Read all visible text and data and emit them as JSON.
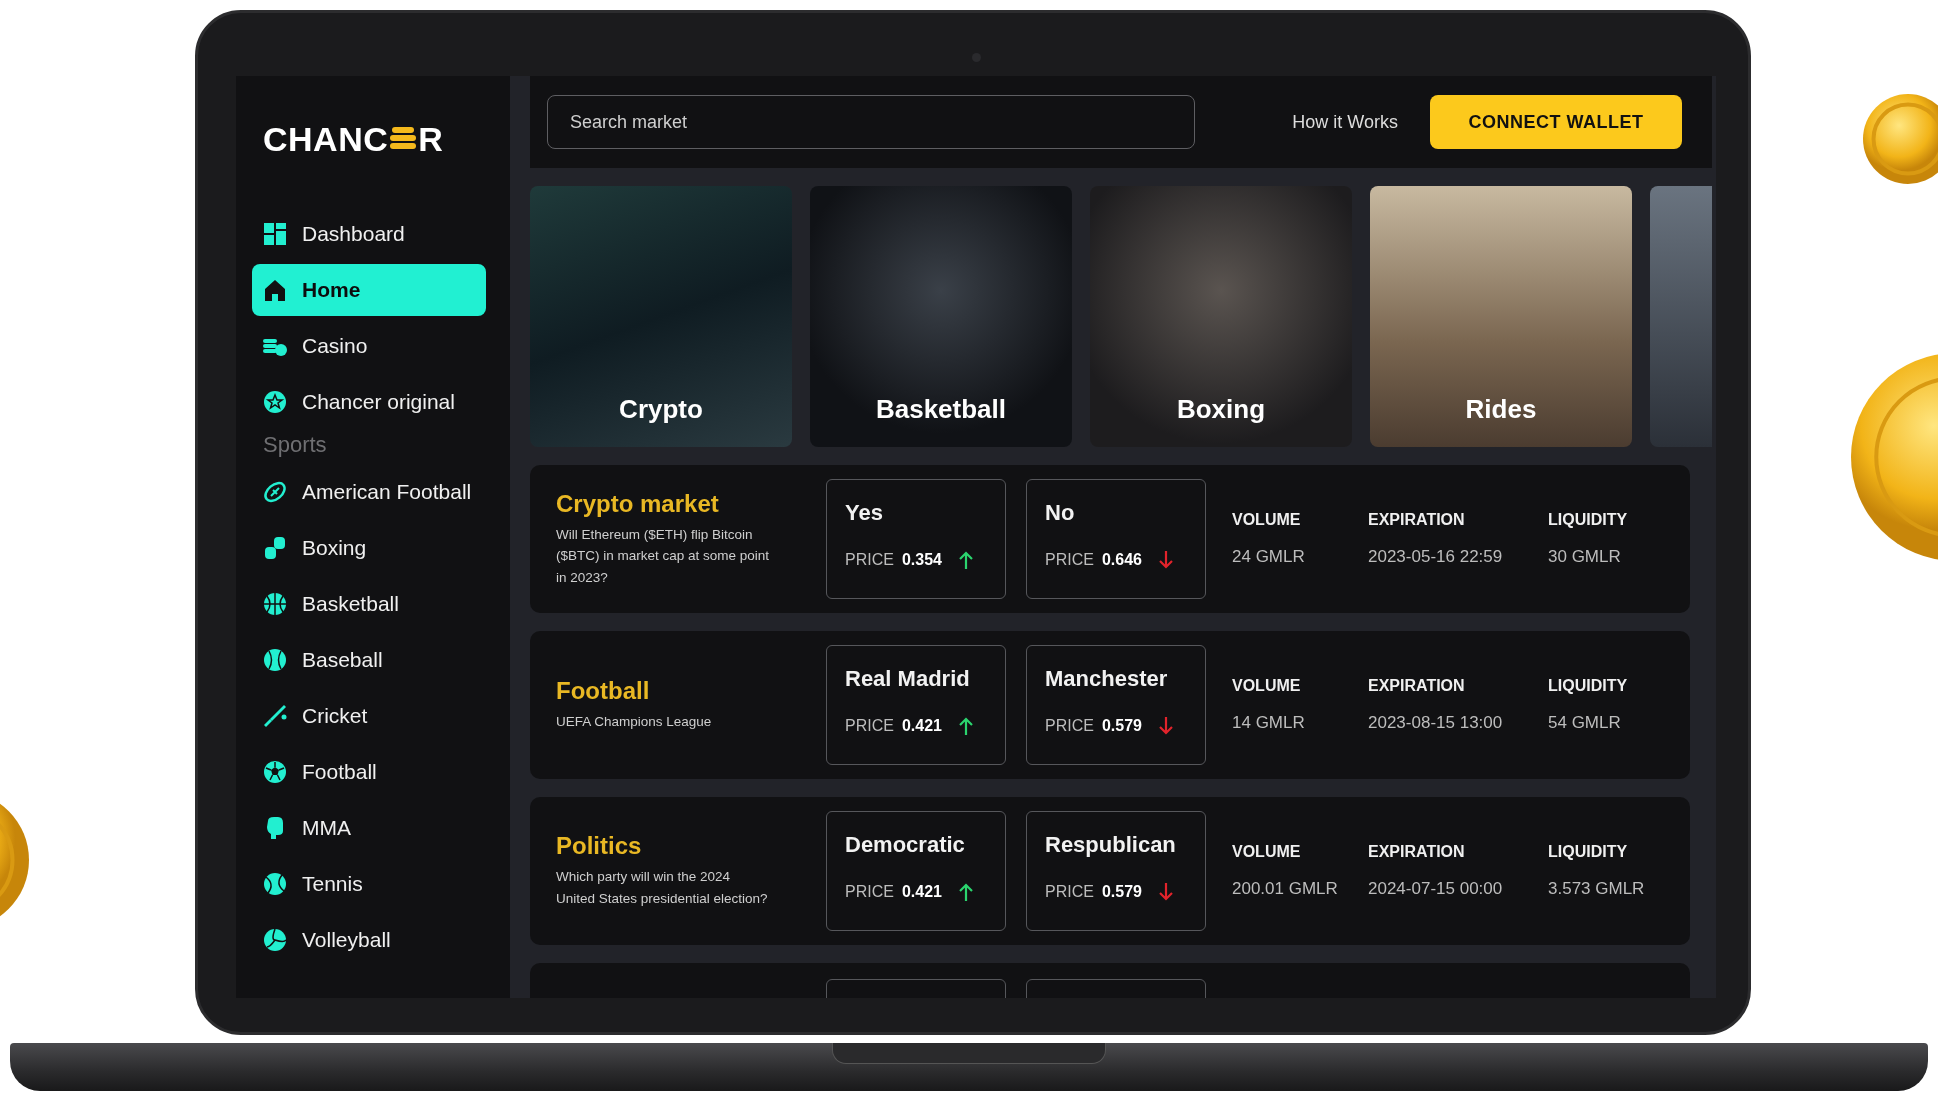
{
  "sidebar": {
    "logo": [
      "CHANC",
      "R"
    ],
    "menu": [
      {
        "label": "Dashboard",
        "selected": false
      },
      {
        "label": "Home",
        "selected": true
      },
      {
        "label": "Casino",
        "selected": false
      },
      {
        "label": "Chancer original",
        "selected": false
      }
    ],
    "sports_heading": "Sports",
    "sports": [
      {
        "label": "American Football",
        "selected": false
      },
      {
        "label": "Boxing",
        "selected": false
      },
      {
        "label": "Basketball",
        "selected": false
      },
      {
        "label": "Baseball",
        "selected": false
      },
      {
        "label": "Cricket",
        "selected": false
      },
      {
        "label": "Football",
        "selected": false
      },
      {
        "label": "MMA",
        "selected": false
      },
      {
        "label": "Tennis",
        "selected": false
      },
      {
        "label": "Volleyball",
        "selected": false
      }
    ]
  },
  "header": {
    "search": {
      "placeholder": "Search market"
    },
    "link": "How it Works",
    "button": "CONNECT WALLET"
  },
  "categories": [
    {
      "label": "Crypto"
    },
    {
      "label": "Basketball"
    },
    {
      "label": "Boxing"
    },
    {
      "label": "Rides"
    }
  ],
  "markets": [
    {
      "title": "Crypto market",
      "description": "Will Ethereum ($ETH) flip Bitcoin ($BTC) in market cap at some point in 2023?",
      "options": [
        {
          "name": "Yes",
          "price_label": "PRICE",
          "price": "0.354",
          "kind": "up"
        },
        {
          "name": "No",
          "price_label": "PRICE",
          "price": "0.646",
          "kind": "down"
        }
      ],
      "stats": [
        {
          "label": "VOLUME",
          "value": "24 GMLR"
        },
        {
          "label": "EXPIRATION",
          "value": "2023-05-16 22:59"
        },
        {
          "label": "LIQUIDITY",
          "value": "30 GMLR"
        }
      ]
    },
    {
      "title": "Football",
      "description": "UEFA Champions League",
      "options": [
        {
          "name": "Real Madrid",
          "price_label": "PRICE",
          "price": "0.421",
          "kind": "up"
        },
        {
          "name": "Manchester",
          "price_label": "PRICE",
          "price": "0.579",
          "kind": "down"
        }
      ],
      "stats": [
        {
          "label": "VOLUME",
          "value": "14 GMLR"
        },
        {
          "label": "EXPIRATION",
          "value": "2023-08-15 13:00"
        },
        {
          "label": "LIQUIDITY",
          "value": "54 GMLR"
        }
      ]
    },
    {
      "title": "Politics",
      "description": "Which party will win the 2024 United States presidential election?",
      "options": [
        {
          "name": "Democratic",
          "price_label": "PRICE",
          "price": "0.421",
          "kind": "up"
        },
        {
          "name": "Respublican",
          "price_label": "PRICE",
          "price": "0.579",
          "kind": "down"
        }
      ],
      "stats": [
        {
          "label": "VOLUME",
          "value": "200.01 GMLR"
        },
        {
          "label": "EXPIRATION",
          "value": "2024-07-15 00:00"
        },
        {
          "label": "LIQUIDITY",
          "value": "3.573 GMLR"
        }
      ]
    }
  ]
}
